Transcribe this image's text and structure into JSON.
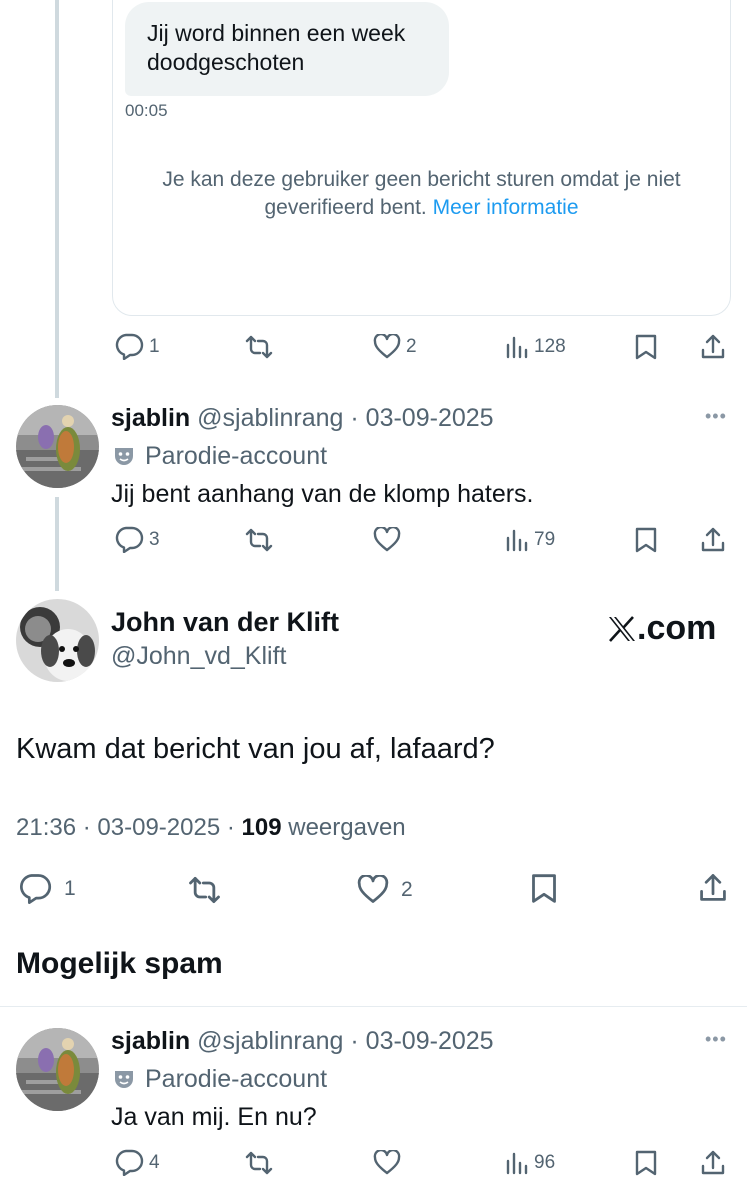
{
  "quoted_card": {
    "message": "Jij word binnen een week doodgeschoten",
    "time": "00:05",
    "notice_text": "Je kan deze gebruiker geen bericht sturen omdat je niet geverifieerd bent.",
    "notice_link": "Meer informatie"
  },
  "actions_1": {
    "replies": "1",
    "likes": "2",
    "views": "128"
  },
  "reply_1": {
    "name": "sjablin",
    "handle": "@sjablinrang",
    "separator": "·",
    "date": "03-09-2025",
    "label": "Parodie-account",
    "text": "Jij bent aanhang van de klomp haters.",
    "replies": "3",
    "views": "79"
  },
  "main_tweet": {
    "name": "John van der Klift",
    "handle": "@John_vd_Klift",
    "brand": ".com",
    "text": "Kwam dat bericht van jou af, lafaard?",
    "time": "21:36",
    "separator": "·",
    "date": "03-09-2025",
    "views_count": "109",
    "views_label": "weergaven",
    "replies": "1",
    "likes": "2"
  },
  "section": {
    "title": "Mogelijk spam"
  },
  "reply_2": {
    "name": "sjablin",
    "handle": "@sjablinrang",
    "separator": "·",
    "date": "03-09-2025",
    "label": "Parodie-account",
    "text": "Ja van mij. En nu?",
    "replies": "4",
    "views": "96"
  },
  "more_label": "•••",
  "colors": {
    "accent": "#1d9bf0",
    "muted": "#536471",
    "text": "#0f1419",
    "border": "#e1e8ed"
  },
  "icons": [
    "reply-icon",
    "retweet-icon",
    "like-icon",
    "views-icon",
    "bookmark-icon",
    "share-icon",
    "more-icon",
    "parody-mask-icon",
    "x-logo-icon"
  ]
}
